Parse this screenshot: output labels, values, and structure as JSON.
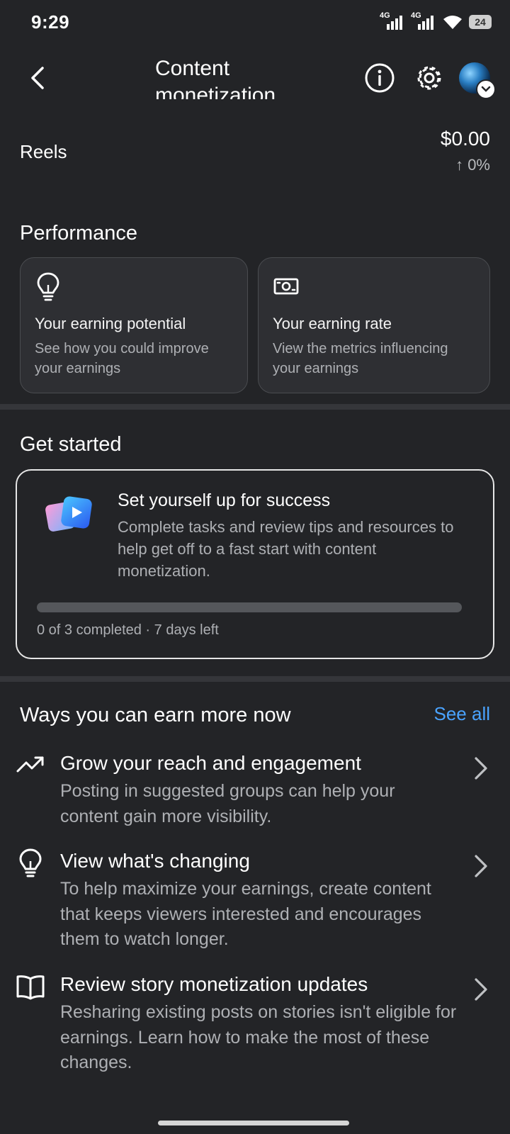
{
  "status_bar": {
    "time": "9:29",
    "signal1": "4G",
    "signal2": "4G",
    "battery": "24"
  },
  "header": {
    "title": "Content monetization"
  },
  "reels": {
    "label": "Reels",
    "amount": "$0.00",
    "change": "↑ 0%"
  },
  "performance": {
    "title": "Performance",
    "cards": [
      {
        "icon": "lightbulb-icon",
        "title": "Your earning potential",
        "subtitle": "See how you could improve your earnings"
      },
      {
        "icon": "money-bill-icon",
        "title": "Your earning rate",
        "subtitle": "View the metrics influencing your earnings"
      }
    ]
  },
  "get_started": {
    "title": "Get started",
    "card_title": "Set yourself up for success",
    "card_body": "Complete tasks and review tips and resources to help get off to a fast start with content monetization.",
    "progress": 0,
    "footer": "0 of 3 completed · 7 days left"
  },
  "ways": {
    "title": "Ways you can earn more now",
    "see_all": "See all",
    "items": [
      {
        "icon": "trending-up-icon",
        "title": "Grow your reach and engagement",
        "desc": "Posting in suggested groups can help your content gain more visibility."
      },
      {
        "icon": "lightbulb-icon",
        "title": "View what's changing",
        "desc": "To help maximize your earnings, create content that keeps viewers interested and encourages them to watch longer."
      },
      {
        "icon": "book-icon",
        "title": "Review story monetization updates",
        "desc": "Resharing existing posts on stories isn't eligible for earnings. Learn how to make the most of these changes."
      }
    ]
  },
  "colors": {
    "background": "#232427",
    "accent": "#4aa3ff",
    "muted_text": "#aeb0b4"
  }
}
